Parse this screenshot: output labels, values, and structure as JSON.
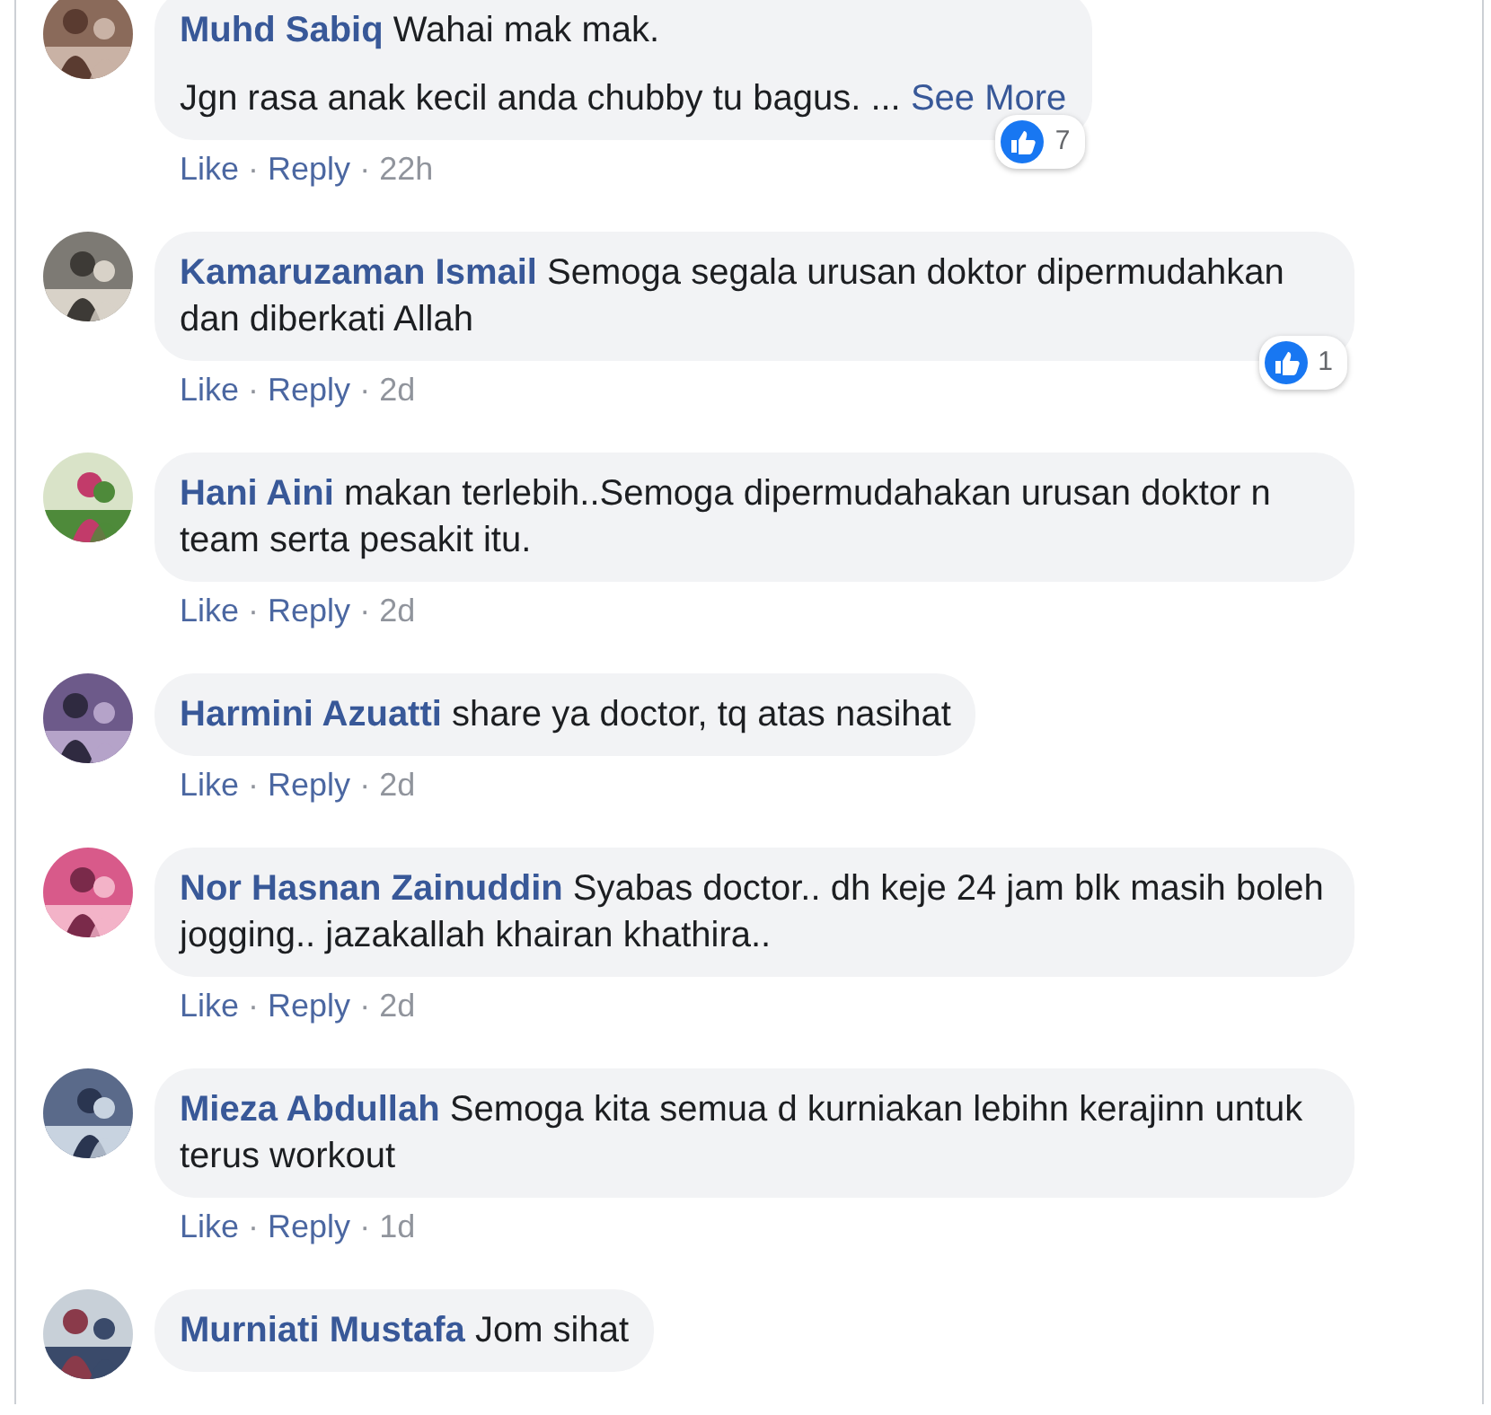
{
  "comments": [
    {
      "name": "Muhd Sabiq",
      "paragraphs": [
        "Wahai mak mak.",
        "Jgn rasa anak kecil anda chubby tu bagus. ..."
      ],
      "see_more": "See More",
      "reactions": "7",
      "like": "Like",
      "reply": "Reply",
      "time": "22h",
      "separator": "·"
    },
    {
      "name": "Kamaruzaman Ismail",
      "paragraphs": [
        "Semoga segala urusan doktor dipermudahkan dan diberkati Allah"
      ],
      "reactions": "1",
      "like": "Like",
      "reply": "Reply",
      "time": "2d",
      "separator": "·"
    },
    {
      "name": "Hani Aini",
      "paragraphs": [
        "makan terlebih..Semoga dipermudahakan urusan doktor n team serta pesakit itu."
      ],
      "like": "Like",
      "reply": "Reply",
      "time": "2d",
      "separator": "·"
    },
    {
      "name": "Harmini Azuatti",
      "paragraphs": [
        "share ya doctor, tq atas nasihat"
      ],
      "like": "Like",
      "reply": "Reply",
      "time": "2d",
      "separator": "·"
    },
    {
      "name": "Nor Hasnan Zainuddin",
      "paragraphs": [
        "Syabas doctor.. dh keje 24 jam blk masih boleh jogging.. jazakallah khairan khathira.."
      ],
      "like": "Like",
      "reply": "Reply",
      "time": "2d",
      "separator": "·"
    },
    {
      "name": "Mieza Abdullah",
      "paragraphs": [
        "Semoga kita semua d kurniakan lebihn kerajinn untuk terus workout"
      ],
      "like": "Like",
      "reply": "Reply",
      "time": "1d",
      "separator": "·"
    },
    {
      "name": "Murniati Mustafa",
      "paragraphs": [
        "Jom sihat"
      ]
    }
  ]
}
